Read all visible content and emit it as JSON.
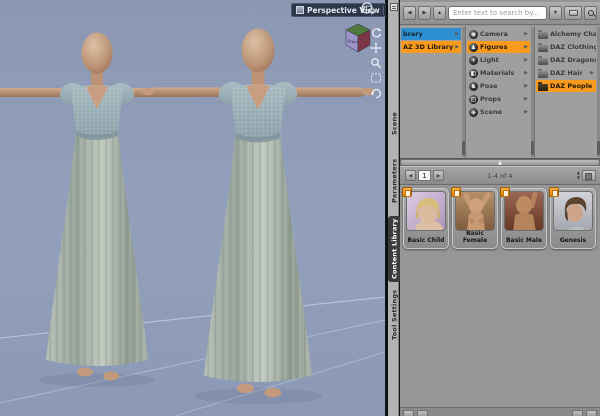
{
  "viewport": {
    "view_selector_label": "Perspective View",
    "view_cube_front_label": "Front"
  },
  "icons": {
    "dropdown_arrow": "▼",
    "item_arrow": "▶",
    "back_arrow": "◀",
    "forward_arrow": "▶",
    "up_arrow": "▲",
    "scroll_marker": "▲",
    "pager_prev": "◀",
    "pager_next": "▶",
    "spinner_up": "▲",
    "spinner_down": "▼"
  },
  "tabs": [
    {
      "label": "Scene"
    },
    {
      "label": "Parameters"
    },
    {
      "label": "Content Library"
    },
    {
      "label": "Tool Settings"
    }
  ],
  "library": {
    "search_placeholder": "Enter text to search by...",
    "columns": {
      "root": [
        {
          "label": "brary"
        },
        {
          "label": "AZ 3D Library"
        }
      ],
      "categories": [
        {
          "label": "Camera",
          "glyph": "◉"
        },
        {
          "label": "Figures",
          "glyph": "♟"
        },
        {
          "label": "Light",
          "glyph": "☀"
        },
        {
          "label": "Materials",
          "glyph": "◧"
        },
        {
          "label": "Pose",
          "glyph": "♞"
        },
        {
          "label": "Props",
          "glyph": "◰"
        },
        {
          "label": "Scene",
          "glyph": "◈"
        }
      ],
      "folders": [
        {
          "label": "Alchemy Chasm"
        },
        {
          "label": "DAZ Clothing"
        },
        {
          "label": "DAZ Dragons"
        },
        {
          "label": "DAZ Hair"
        },
        {
          "label": "DAZ People"
        }
      ]
    },
    "pager": {
      "page": "1",
      "range": "1-4 of 4"
    },
    "assets": [
      {
        "label": "Basic Child"
      },
      {
        "label": "Basic Female"
      },
      {
        "label": "Basic Male"
      },
      {
        "label": "Genesis"
      }
    ]
  },
  "colors": {
    "selection_blue": "#2E8FD0",
    "selection_orange": "#F79A1E",
    "viewport_sky": "#8C99B6"
  }
}
